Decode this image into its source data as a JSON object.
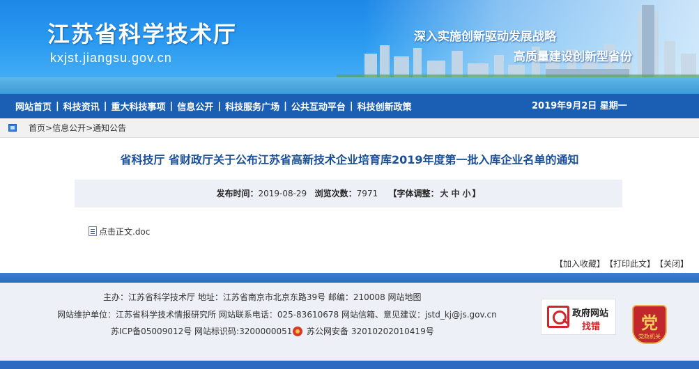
{
  "banner": {
    "title": "江苏省科学技术厅",
    "domain": "kxjst.jiangsu.gov.cn",
    "slogan_line1": "深入实施创新驱动发展战略",
    "slogan_line2": "高质量建设创新型省份"
  },
  "nav": {
    "items": [
      "网站首页",
      "科技资讯",
      "重大科技事项",
      "信息公开",
      "科技服务广场",
      "公共互动平台",
      "科技创新政策"
    ],
    "separator": "|",
    "date": "2019年9月2日 星期一"
  },
  "breadcrumb": {
    "home": "首页",
    "section": "信息公开",
    "current": "通知公告",
    "separator": ">"
  },
  "article": {
    "title": "省科技厅 省财政厅关于公布江苏省高新技术企业培育库2019年度第一批入库企业名单的通知",
    "publish_label": "发布时间：",
    "publish_date": "2019-08-29",
    "views_label": "浏览次数：",
    "views": "7971",
    "font_adjust_open": "【字体调整：",
    "font_large": "大",
    "font_medium": "中",
    "font_small": "小",
    "font_adjust_close": "】",
    "attachment_label": "点击正文.doc"
  },
  "actions": {
    "favorite": "【加入收藏】",
    "print": "【打印此文】",
    "close": "【关闭】"
  },
  "footer": {
    "line1": "主办：江苏省科学技术厅 地址：江苏省南京市北京东路39号 邮编：210008 网站地图",
    "line2": "网站维护单位：江苏省科学技术情报研究所 网站联系电话：025-83610678 网站信箱、意见建议：jstd_kj@js.gov.cn",
    "icp": "苏ICP备05009012号 网站标识码:3200000051",
    "police": "苏公网安备 32010202010419号",
    "gov_find_line1": "政府网站",
    "gov_find_line2": "找错",
    "party_badge_glyph": "党",
    "party_badge_label": "党政机关"
  },
  "colors": {
    "nav_bg": "#1a5fb4",
    "title_blue": "#1a4f9a",
    "footer_bg": "#eef0f7",
    "find_red": "#d0232b"
  }
}
